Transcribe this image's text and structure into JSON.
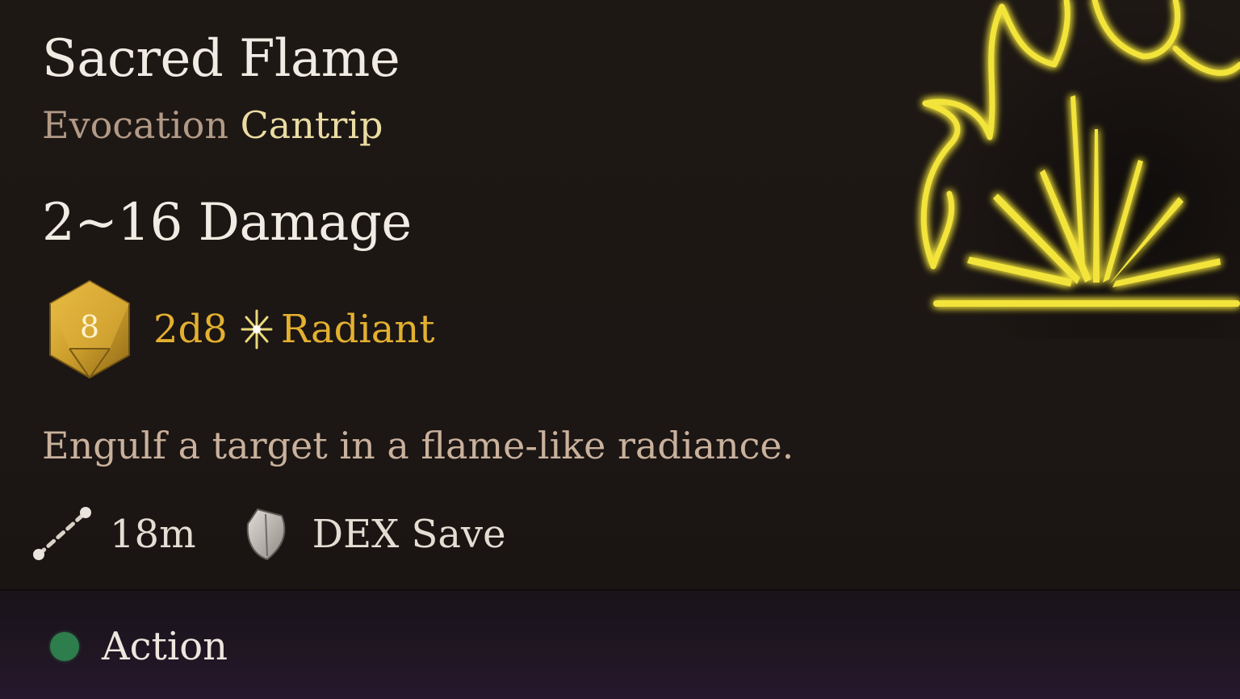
{
  "spell": {
    "name": "Sacred Flame",
    "school": "Evocation",
    "level": "Cantrip",
    "damage_heading": "2~16 Damage",
    "die_face": "8",
    "dice": "2d8",
    "damage_type": "Radiant",
    "description": "Engulf a target in a flame-like radiance."
  },
  "properties": {
    "range": "18m",
    "save": "DEX Save"
  },
  "footer": {
    "resource_label": "Action"
  },
  "icons": {
    "spell_art": "sacred-flame-icon",
    "die": "d8-die-icon",
    "damage_type": "radiant-icon",
    "range": "range-icon",
    "save": "shield-icon",
    "resource": "action-dot-icon"
  },
  "colors": {
    "title": "#f1ece3",
    "school": "#b29a86",
    "level": "#eadca2",
    "damage": "#e3b02f",
    "description": "#c9b19c",
    "action": "#2e7d4c",
    "flame": "#f2e23a"
  }
}
